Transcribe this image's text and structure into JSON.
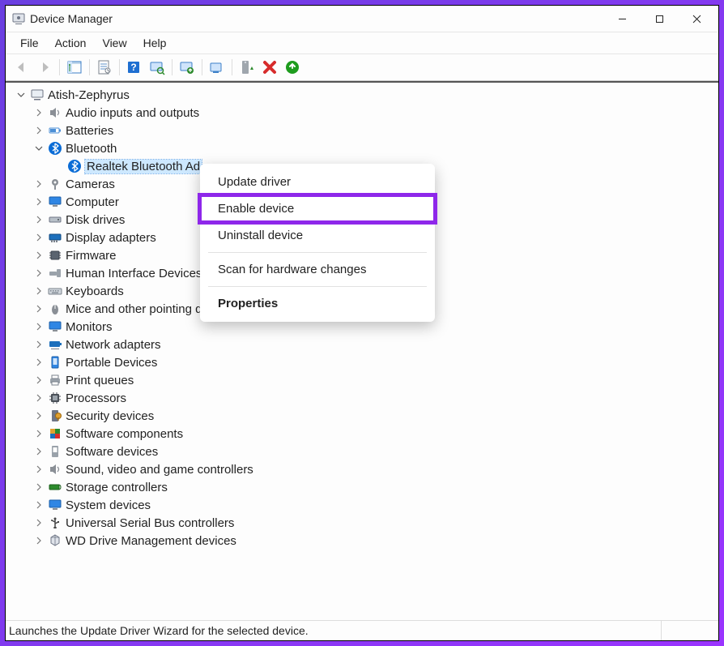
{
  "window": {
    "title": "Device Manager"
  },
  "menu": {
    "file": "File",
    "action": "Action",
    "view": "View",
    "help": "Help"
  },
  "tree": {
    "root": "Atish-Zephyrus",
    "items": {
      "audio": "Audio inputs and outputs",
      "batteries": "Batteries",
      "bluetooth": "Bluetooth",
      "bt_realtek": "Realtek Bluetooth Ad",
      "cameras": "Cameras",
      "computer": "Computer",
      "disk": "Disk drives",
      "display": "Display adapters",
      "firmware": "Firmware",
      "hid": "Human Interface Devices",
      "keyboards": "Keyboards",
      "mice": "Mice and other pointing devices",
      "monitors": "Monitors",
      "network": "Network adapters",
      "portable": "Portable Devices",
      "print": "Print queues",
      "processors": "Processors",
      "security": "Security devices",
      "swcomp": "Software components",
      "swdev": "Software devices",
      "sound": "Sound, video and game controllers",
      "storage": "Storage controllers",
      "system": "System devices",
      "usb": "Universal Serial Bus controllers",
      "wd": "WD Drive Management devices"
    }
  },
  "context_menu": {
    "update": "Update driver",
    "enable": "Enable device",
    "uninstall": "Uninstall device",
    "scan": "Scan for hardware changes",
    "properties": "Properties"
  },
  "statusbar": {
    "text": "Launches the Update Driver Wizard for the selected device."
  }
}
